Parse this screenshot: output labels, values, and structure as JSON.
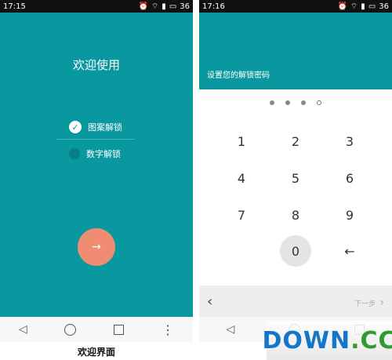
{
  "left_phone": {
    "status": {
      "time": "17:15",
      "battery": "36"
    },
    "title": "欢迎使用",
    "options": [
      "图案解锁",
      "数字解锁"
    ],
    "selected_option": 0,
    "next_icon": "→",
    "nav": {
      "back_icon": "◁",
      "home_icon": "○",
      "recents_icon": "□",
      "menu_icon": "⋮"
    }
  },
  "right_phone": {
    "status": {
      "time": "17:16",
      "battery": "36"
    },
    "title": "设置您的解锁密码",
    "pin": {
      "filled": 3,
      "total": 4
    },
    "keys": [
      "1",
      "2",
      "3",
      "4",
      "5",
      "6",
      "7",
      "8",
      "9",
      "0",
      "←"
    ],
    "bottom": {
      "back_icon": "‹",
      "next_label": "下一步",
      "next_icon": "›"
    },
    "nav": {
      "back_icon": "◁"
    }
  },
  "captions": {
    "left": "欢迎界面"
  },
  "watermark": {
    "text_main": "DOWN",
    "text_cc": ".CC"
  },
  "colors": {
    "teal": "#0a98a0",
    "next_button": "#ef8c72"
  }
}
